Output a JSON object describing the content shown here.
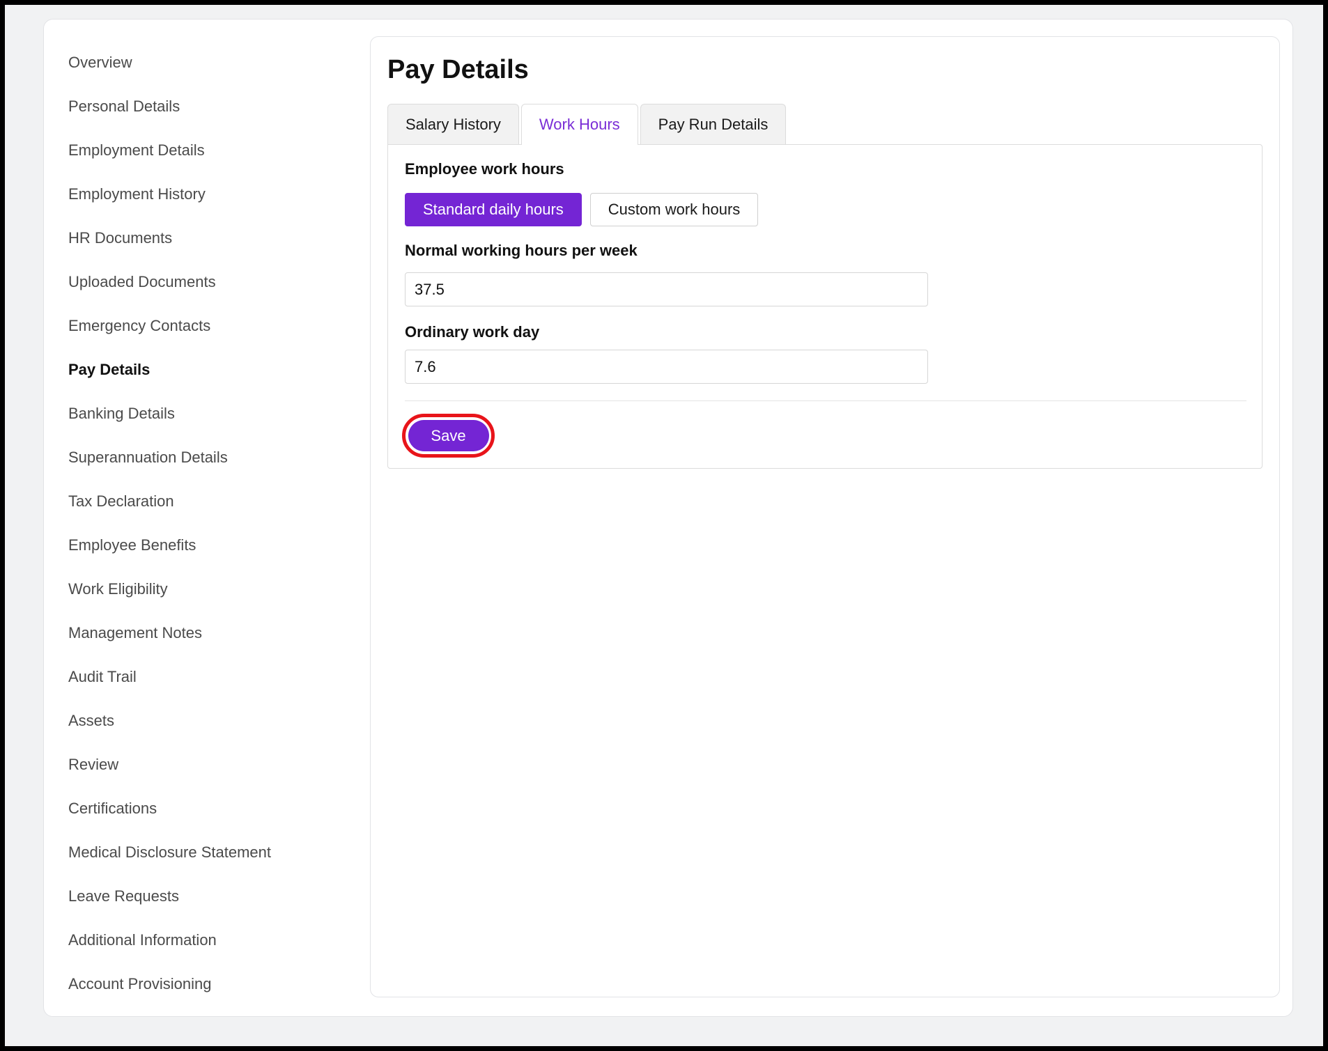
{
  "sidebar": {
    "items": [
      {
        "label": "Overview"
      },
      {
        "label": "Personal Details"
      },
      {
        "label": "Employment Details"
      },
      {
        "label": "Employment History"
      },
      {
        "label": "HR Documents"
      },
      {
        "label": "Uploaded Documents"
      },
      {
        "label": "Emergency Contacts"
      },
      {
        "label": "Pay Details"
      },
      {
        "label": "Banking Details"
      },
      {
        "label": "Superannuation Details"
      },
      {
        "label": "Tax Declaration"
      },
      {
        "label": "Employee Benefits"
      },
      {
        "label": "Work Eligibility"
      },
      {
        "label": "Management Notes"
      },
      {
        "label": "Audit Trail"
      },
      {
        "label": "Assets"
      },
      {
        "label": "Review"
      },
      {
        "label": "Certifications"
      },
      {
        "label": "Medical Disclosure Statement"
      },
      {
        "label": "Leave Requests"
      },
      {
        "label": "Additional Information"
      },
      {
        "label": "Account Provisioning"
      }
    ],
    "active_label": "Pay Details"
  },
  "main": {
    "title": "Pay Details",
    "tabs": [
      {
        "label": "Salary History"
      },
      {
        "label": "Work Hours"
      },
      {
        "label": "Pay Run Details"
      }
    ],
    "active_tab": "Work Hours",
    "work_hours": {
      "employee_work_hours_label": "Employee work hours",
      "options": [
        {
          "label": "Standard daily hours"
        },
        {
          "label": "Custom work hours"
        }
      ],
      "selected_option": "Standard daily hours",
      "normal_hours_label": "Normal working hours per week",
      "normal_hours_value": "37.5",
      "ordinary_day_label": "Ordinary work day",
      "ordinary_day_value": "7.6",
      "save_label": "Save"
    }
  },
  "colors": {
    "accent": "#7425d4",
    "active_tab_text": "#7a2dd6",
    "highlight": "#e8141a",
    "page_background": "#f1f2f3"
  }
}
